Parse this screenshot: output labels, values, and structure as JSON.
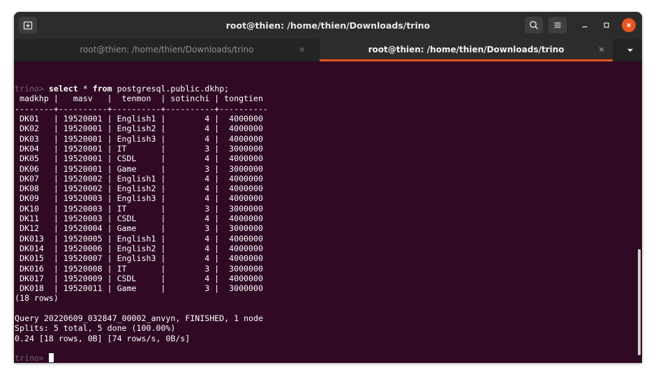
{
  "window": {
    "title": "root@thien: /home/thien/Downloads/trino"
  },
  "tabs": [
    {
      "label": "root@thien: /home/thien/Downloads/trino",
      "active": false
    },
    {
      "label": "root@thien: /home/thien/Downloads/trino",
      "active": true
    }
  ],
  "terminal": {
    "prompt": "trino>",
    "command_select": "select",
    "command_star": " * ",
    "command_from": "from",
    "command_rest": " postgresql.public.dkhp;",
    "header": " madkhp |   masv   |  tenmon  | sotinchi | tongtien ",
    "separator": "--------+----------+----------+----------+----------",
    "rows": [
      " DK01   | 19520001 | English1 |        4 |  4000000 ",
      " DK02   | 19520001 | English2 |        4 |  4000000 ",
      " DK03   | 19520001 | English3 |        4 |  4000000 ",
      " DK04   | 19520001 | IT       |        3 |  3000000 ",
      " DK05   | 19520001 | CSDL     |        4 |  4000000 ",
      " DK06   | 19520001 | Game     |        3 |  3000000 ",
      " DK07   | 19520002 | English1 |        4 |  4000000 ",
      " DK08   | 19520002 | English2 |        4 |  4000000 ",
      " DK09   | 19520003 | English3 |        4 |  4000000 ",
      " DK10   | 19520003 | IT       |        3 |  3000000 ",
      " DK11   | 19520003 | CSDL     |        4 |  4000000 ",
      " DK12   | 19520004 | Game     |        3 |  3000000 ",
      " DK013  | 19520005 | English1 |        4 |  4000000 ",
      " DK014  | 19520006 | English2 |        4 |  4000000 ",
      " DK015  | 19520007 | English3 |        4 |  4000000 ",
      " DK016  | 19520008 | IT       |        3 |  3000000 ",
      " DK017  | 19520009 | CSDL     |        4 |  4000000 ",
      " DK018  | 19520011 | Game     |        3 |  3000000 "
    ],
    "row_count": "(18 rows)",
    "query_info": "Query 20220609_032847_00002_anvyn, FINISHED, 1 node",
    "splits": "Splits: 5 total, 5 done (100.00%)",
    "stats": "0.24 [18 rows, 0B] [74 rows/s, 0B/s]",
    "final_prompt": "trino>"
  },
  "colors": {
    "terminal_background": "#300a24",
    "titlebar_background": "#2c2c2c",
    "accent": "#e95420",
    "text": "#ffffff",
    "prompt_dim": "#6f6470"
  },
  "icons": {
    "new_tab": "new-tab-icon",
    "search": "search-icon",
    "menu": "hamburger-menu-icon",
    "minimize": "minimize-icon",
    "maximize": "maximize-icon",
    "close": "close-icon",
    "tab_close": "close-icon",
    "tabs_dropdown": "chevron-down-icon"
  }
}
